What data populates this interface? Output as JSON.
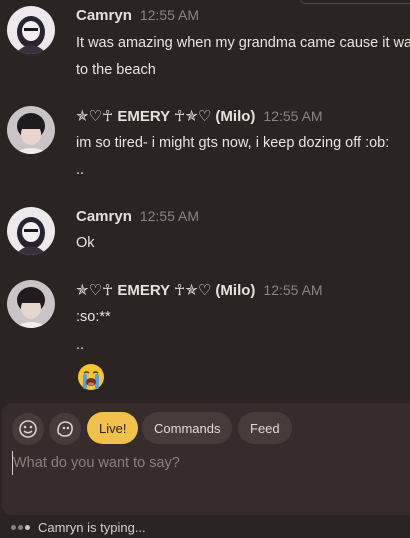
{
  "messages": [
    {
      "author": "Camryn",
      "time": "12:55 AM",
      "lines": [
        "It was amazing when my grandma came cause it was",
        "to the beach"
      ]
    },
    {
      "author": "✯♡☥ EMERY ☥✯♡ (Milo)",
      "time": "12:55 AM",
      "lines": [
        "im so tired- i might gts now, i keep dozing off :ob:",
        ".."
      ]
    },
    {
      "author": "Camryn",
      "time": "12:55 AM",
      "lines": [
        "Ok"
      ]
    },
    {
      "author": "✯♡☥ EMERY ☥✯♡ (Milo)",
      "time": "12:55 AM",
      "lines": [
        ":so:**",
        ".."
      ],
      "emoji": "loudly-crying-face"
    }
  ],
  "composer": {
    "icons": [
      "emoji-face-icon",
      "emoji-blob-icon"
    ],
    "chips": [
      "Live!",
      "Commands",
      "Feed"
    ],
    "placeholder": "What do you want to say?"
  },
  "typing": {
    "text": "Camryn is typing..."
  },
  "colors": {
    "background": "#2a2422",
    "composer": "#342d2b",
    "live_chip": "#f2c14a",
    "timestamp": "#8d8380"
  }
}
